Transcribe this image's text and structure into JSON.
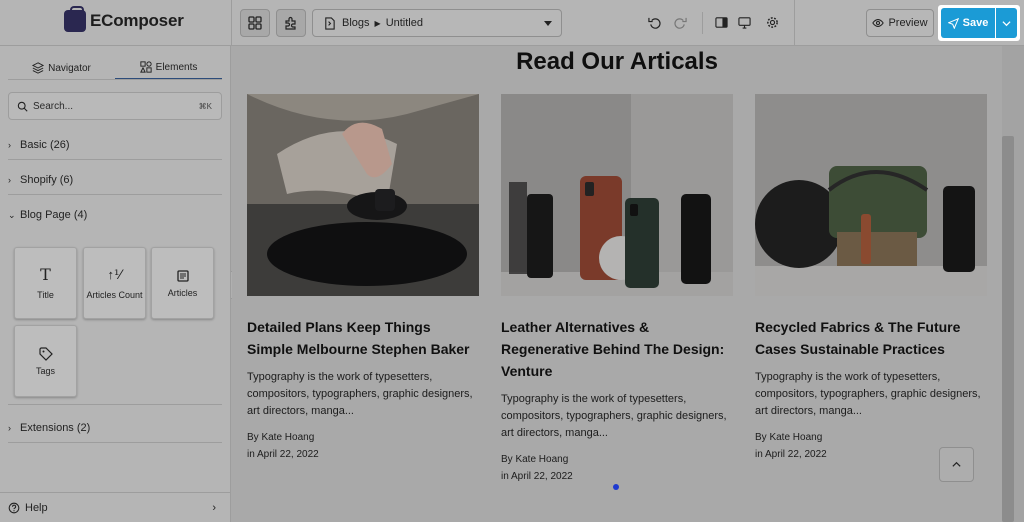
{
  "app": {
    "name": "EComposer"
  },
  "toolbar": {
    "page_select": {
      "section": "Blogs",
      "page": "Untitled"
    },
    "preview_label": "Preview",
    "save_label": "Save"
  },
  "sidebar": {
    "tabs": [
      {
        "label": "Navigator",
        "icon": "layers-icon"
      },
      {
        "label": "Elements",
        "icon": "elements-grid-icon",
        "active": true
      }
    ],
    "search": {
      "placeholder": "Search...",
      "shortcut": "⌘K"
    },
    "sections": [
      {
        "label": "Basic (26)",
        "expanded": false
      },
      {
        "label": "Shopify (6)",
        "expanded": false
      },
      {
        "label": "Blog Page (4)",
        "expanded": true
      },
      {
        "label": "Extensions (2)",
        "expanded": false
      }
    ],
    "widgets": [
      {
        "label": "Title",
        "icon": "title-text-icon"
      },
      {
        "label": "Articles Count",
        "icon": "sort-number-icon"
      },
      {
        "label": "Articles",
        "icon": "articles-icon"
      },
      {
        "label": "Tags",
        "icon": "tag-icon"
      }
    ],
    "help_label": "Help"
  },
  "canvas": {
    "heading": "Read Our Articals",
    "articles": [
      {
        "title": "Detailed Plans Keep Things Simple Melbourne Stephen Baker",
        "excerpt": "Typography is the work of typesetters, compositors, typographers, graphic designers, art directors, manga...",
        "author": "By Kate Hoang",
        "date": "in April 22, 2022"
      },
      {
        "title": "Leather Alternatives & Regenerative Behind The Design: Venture",
        "excerpt": "Typography is the work of typesetters, compositors, typographers, graphic designers, art directors, manga...",
        "author": "By Kate Hoang",
        "date": "in April 22, 2022"
      },
      {
        "title": "Recycled Fabrics & The Future Cases Sustainable Practices",
        "excerpt": "Typography is the work of typesetters, compositors, typographers, graphic designers, art directors, manga...",
        "author": "By Kate Hoang",
        "date": "in April 22, 2022"
      }
    ]
  },
  "colors": {
    "accent": "#1b9bd6",
    "overlay_background": "#a9a9a9",
    "carousel_dot": "#1e3ad0"
  }
}
